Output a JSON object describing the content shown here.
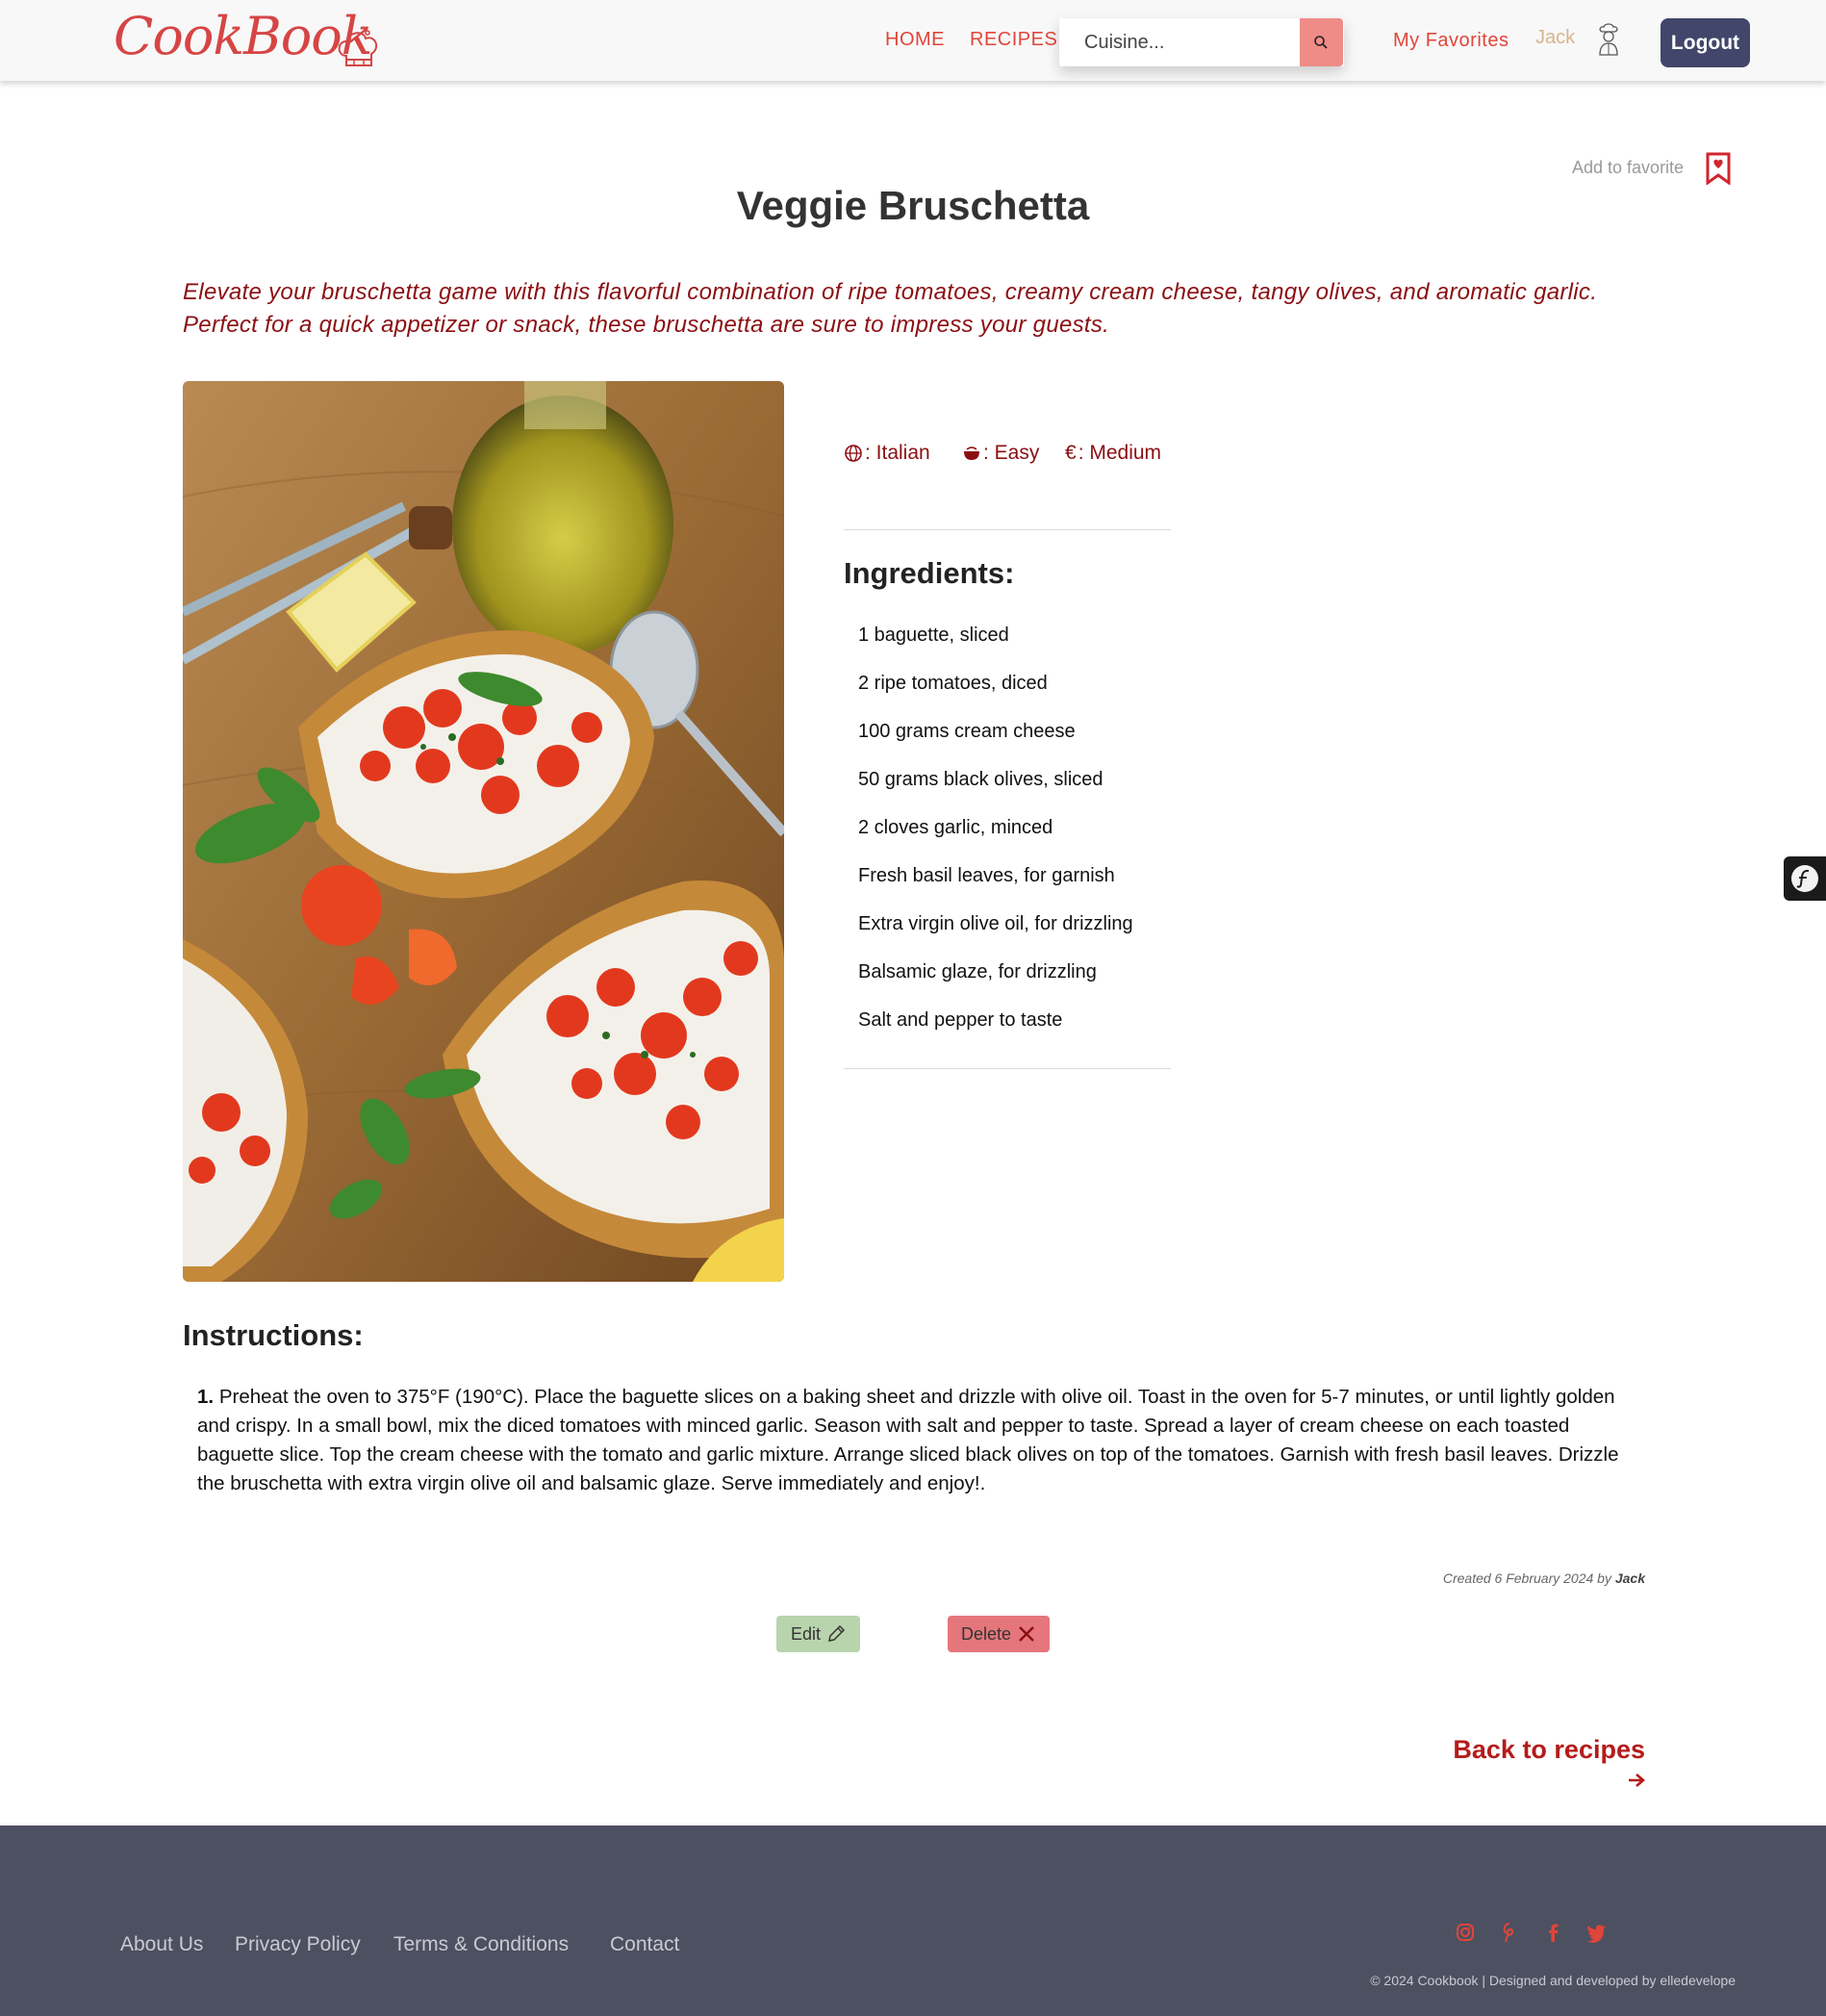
{
  "header": {
    "logo_text": "CookBook",
    "nav": {
      "home": "HOME",
      "recipes": "RECIPES"
    },
    "search_placeholder": "Cuisine...",
    "favorites": "My Favorites",
    "user_name": "Jack",
    "logout": "Logout"
  },
  "recipe": {
    "add_favorite": "Add to favorite",
    "title": "Veggie Bruschetta",
    "intro": "Elevate your bruschetta game with this flavorful combination of ripe tomatoes, creamy cream cheese, tangy olives, and aromatic garlic. Perfect for a quick appetizer or snack, these bruschetta are sure to impress your guests.",
    "meta": {
      "cuisine": ": Italian",
      "difficulty": ": Easy",
      "cost_symbol": "€",
      "cost": ": Medium"
    },
    "ingredients_title": "Ingredients:",
    "ingredients": [
      "1 baguette, sliced",
      "2 ripe tomatoes, diced",
      "100 grams cream cheese",
      "50 grams black olives, sliced",
      "2 cloves garlic, minced",
      "Fresh basil leaves, for garnish",
      "Extra virgin olive oil, for drizzling",
      "Balsamic glaze, for drizzling",
      "Salt and pepper to taste"
    ],
    "instructions_title": "Instructions:",
    "instructions": [
      {
        "num": "1.",
        "text": "Preheat the oven to 375°F (190°C). Place the baguette slices on a baking sheet and drizzle with olive oil. Toast in the oven for 5-7 minutes, or until lightly golden and crispy. In a small bowl, mix the diced tomatoes with minced garlic. Season with salt and pepper to taste. Spread a layer of cream cheese on each toasted baguette slice. Top the cream cheese with the tomato and garlic mixture. Arrange sliced black olives on top of the tomatoes. Garnish with fresh basil leaves. Drizzle the bruschetta with extra virgin olive oil and balsamic glaze. Serve immediately and enjoy!."
      }
    ],
    "created_prefix": "Created 6 February 2024 by",
    "created_by": "Jack",
    "edit": "Edit",
    "delete": "Delete",
    "back": "Back to recipes"
  },
  "footer": {
    "links": [
      "About Us",
      "Privacy Policy",
      "Terms & Conditions",
      "Contact"
    ],
    "social_icons": [
      "instagram-icon",
      "pinterest-icon",
      "facebook-icon",
      "twitter-icon"
    ],
    "copyright": "© 2024 Cookbook | Designed and developed by elledevelope"
  },
  "colors": {
    "brand_red": "#d64545",
    "nav_red": "#e0453a",
    "dark_red": "#8b0f12",
    "logout_bg": "#41466a",
    "footer_bg": "#4d5060",
    "edit_bg": "#b8d4ad",
    "delete_bg": "#e5767b"
  }
}
